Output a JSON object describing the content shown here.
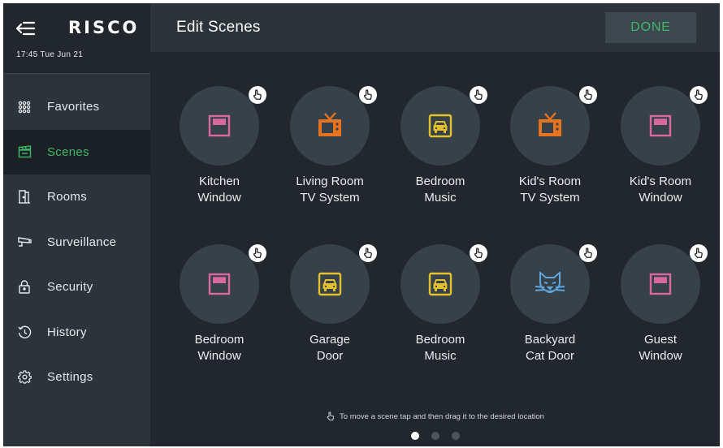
{
  "app": {
    "logo_text": "RISCO",
    "datetime": "17:45 Tue Jun 21"
  },
  "sidebar": {
    "items": [
      {
        "label": "Favorites",
        "icon": "grid-icon",
        "active": false
      },
      {
        "label": "Scenes",
        "icon": "clapperboard-icon",
        "active": true
      },
      {
        "label": "Rooms",
        "icon": "door-icon",
        "active": false
      },
      {
        "label": "Surveillance",
        "icon": "camera-icon",
        "active": false
      },
      {
        "label": "Security",
        "icon": "lock-icon",
        "active": false
      },
      {
        "label": "History",
        "icon": "history-icon",
        "active": false
      },
      {
        "label": "Settings",
        "icon": "gear-icon",
        "active": false
      }
    ]
  },
  "header": {
    "title": "Edit Scenes",
    "done_label": "DONE"
  },
  "scenes": [
    {
      "line1": "Kitchen",
      "line2": "Window",
      "icon": "window-icon",
      "color": "#d9689f"
    },
    {
      "line1": "Living Room",
      "line2": "TV System",
      "icon": "tv-icon",
      "color": "#e8731f"
    },
    {
      "line1": "Bedroom",
      "line2": "Music",
      "icon": "car-icon",
      "color": "#e3c12a"
    },
    {
      "line1": "Kid's Room",
      "line2": "TV System",
      "icon": "tv-icon",
      "color": "#e8731f"
    },
    {
      "line1": "Kid's Room",
      "line2": "Window",
      "icon": "window-icon",
      "color": "#d9689f"
    },
    {
      "line1": "Bedroom",
      "line2": "Window",
      "icon": "window-icon",
      "color": "#d9689f"
    },
    {
      "line1": "Garage",
      "line2": "Door",
      "icon": "car-icon",
      "color": "#e3c12a"
    },
    {
      "line1": "Bedroom",
      "line2": "Music",
      "icon": "car-icon",
      "color": "#e3c12a"
    },
    {
      "line1": "Backyard",
      "line2": "Cat Door",
      "icon": "cat-icon",
      "color": "#5ea6dc"
    },
    {
      "line1": "Guest",
      "line2": "Window",
      "icon": "window-icon",
      "color": "#d9689f"
    }
  ],
  "hint": {
    "text": "To move a scene tap and then drag it to the desired location"
  },
  "pagination": {
    "pages": 3,
    "current": 1
  },
  "colors": {
    "accent": "#3fb86b",
    "background": "#21272c",
    "panel": "#2c343a",
    "tile": "#36414a"
  }
}
